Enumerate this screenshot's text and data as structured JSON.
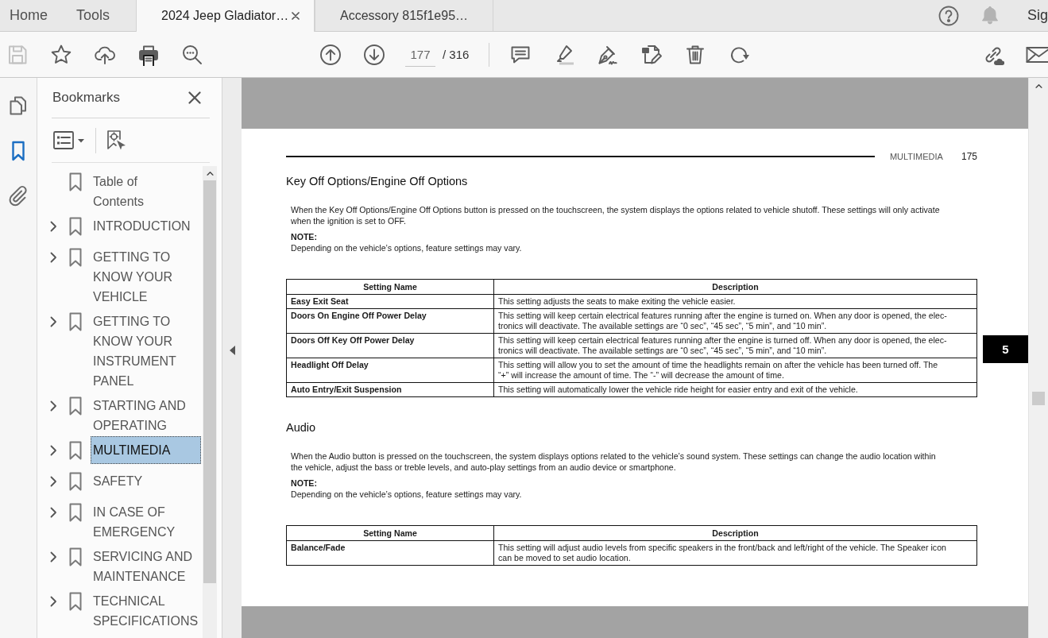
{
  "tabs": [
    {
      "label": "Home",
      "kind": "nav",
      "selected": false
    },
    {
      "label": "Tools",
      "kind": "nav",
      "selected": false
    },
    {
      "label": "2024 Jeep Gladiator…",
      "kind": "document",
      "selected": true
    },
    {
      "label": "Accessory 815f1e95…",
      "kind": "document",
      "selected": false
    }
  ],
  "account_link": "Sig",
  "toolbar": {
    "save": {
      "disabled": true
    },
    "page_number": "177",
    "page_total": "/ 316"
  },
  "rail": [
    {
      "kind": "pages",
      "selected": false
    },
    {
      "kind": "bookmarks",
      "selected": true
    },
    {
      "kind": "attachments",
      "selected": false
    }
  ],
  "bookmarks_panel": {
    "title": "Bookmarks",
    "items": [
      {
        "label": "Table of\nContents",
        "kind": "leaf",
        "selected": false
      },
      {
        "label": "INTRODUCTION",
        "kind": "group",
        "expanded": false,
        "selected": false
      },
      {
        "label": "GETTING TO\nKNOW YOUR\nVEHICLE",
        "kind": "group",
        "expanded": false,
        "selected": false
      },
      {
        "label": "GETTING TO\nKNOW YOUR\nINSTRUMENT\nPANEL",
        "kind": "group",
        "expanded": false,
        "selected": false
      },
      {
        "label": "STARTING AND\nOPERATING",
        "kind": "group",
        "expanded": false,
        "selected": false
      },
      {
        "label": "MULTIMEDIA",
        "kind": "group",
        "expanded": false,
        "selected": true
      },
      {
        "label": "SAFETY",
        "kind": "group",
        "expanded": false,
        "selected": false
      },
      {
        "label": "IN CASE OF\nEMERGENCY",
        "kind": "group",
        "expanded": false,
        "selected": false
      },
      {
        "label": "SERVICING AND\nMAINTENANCE",
        "kind": "group",
        "expanded": false,
        "selected": false
      },
      {
        "label": "TECHNICAL\nSPECIFICATIONS",
        "kind": "group",
        "expanded": false,
        "selected": false
      }
    ]
  },
  "document": {
    "page_header": {
      "section": "MULTIMEDIA",
      "page_number": "175"
    },
    "chapter_tab": "5",
    "sections": [
      {
        "heading": "Key Off Options/Engine Off Options",
        "paragraph": "When the Key Off Options/Engine Off Options button is pressed on the touchscreen, the system displays the options related to vehicle shutoff. These settings will only activate\nwhen the ignition is set to OFF.",
        "note_label": "NOTE:",
        "note_text": "Depending on the vehicle’s options, feature settings may vary.",
        "table": {
          "columns": [
            "Setting Name",
            "Description"
          ],
          "rows": [
            [
              "Easy Exit Seat",
              "This setting adjusts the seats to make exiting the vehicle easier."
            ],
            [
              "Doors On Engine Off Power Delay",
              "This setting will keep certain electrical features running after the engine is turned on. When any door is opened, the elec-\ntronics will deactivate. The available settings are “0 sec”, “45 sec”, “5 min”, and “10 min”."
            ],
            [
              "Doors Off Key Off Power Delay",
              "This setting will keep certain electrical features running after the engine is turned off. When any door is opened, the elec-\ntronics will deactivate. The available settings are “0 sec”, “45 sec”, “5 min”, and “10 min”."
            ],
            [
              "Headlight Off Delay",
              "This setting will allow you to set the amount of time the headlights remain on after the vehicle has been turned off. The\n“+” will increase the amount of time. The “-” will decrease the amount of time."
            ],
            [
              "Auto Entry/Exit Suspension",
              "This setting will automatically lower the vehicle ride height for easier entry and exit of the vehicle."
            ]
          ]
        }
      },
      {
        "heading": "Audio",
        "paragraph": "When the Audio button is pressed on the touchscreen, the system displays options related to the vehicle’s sound system. These settings can change the audio location within\nthe vehicle, adjust the bass or treble levels, and auto-play settings from an audio device or smartphone.",
        "note_label": "NOTE:",
        "note_text": "Depending on the vehicle’s options, feature settings may vary.",
        "table": {
          "columns": [
            "Setting Name",
            "Description"
          ],
          "rows": [
            [
              "Balance/Fade",
              "This setting will adjust audio levels from specific speakers in the front/back and left/right of the vehicle. The Speaker icon\ncan be moved to set audio location."
            ]
          ]
        }
      }
    ]
  }
}
